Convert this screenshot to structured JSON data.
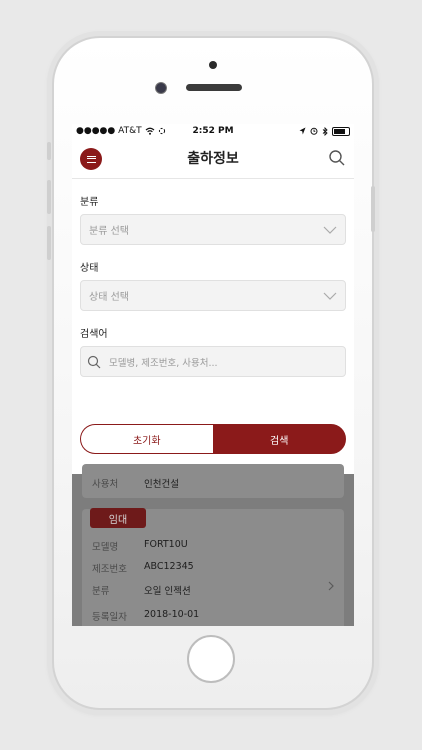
{
  "status_bar": {
    "carrier": "●●●●● AT&T",
    "time": "2:52 PM"
  },
  "header": {
    "title": "출하정보"
  },
  "filters": {
    "category_label": "분류",
    "category_placeholder": "분류 선택",
    "status_label": "상태",
    "status_placeholder": "상태 선택",
    "keyword_label": "검색어",
    "keyword_placeholder": "모델병, 제조번호, 사용처..."
  },
  "buttons": {
    "reset": "초기화",
    "search": "검색"
  },
  "list": {
    "partial_row": {
      "key": "사용처",
      "value": "인천건설"
    },
    "card": {
      "tag": "임대",
      "rows": [
        {
          "key": "모델명",
          "value": "FORT10U"
        },
        {
          "key": "제조번호",
          "value": "ABC12345"
        },
        {
          "key": "분류",
          "value": "오일 인젝션"
        },
        {
          "key": "등록일자",
          "value": "2018-10-01"
        }
      ]
    }
  },
  "colors": {
    "accent": "#8b1a1a",
    "overlay": "#7d7d7d"
  }
}
